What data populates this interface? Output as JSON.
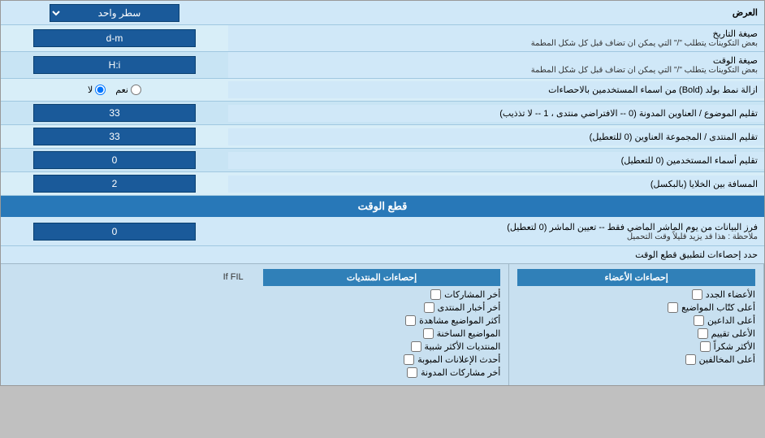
{
  "header": {
    "label": "العرض",
    "dropdown_label": "سطر واحد"
  },
  "rows": [
    {
      "id": "date_format",
      "label": "صيغة التاريخ",
      "sub_label": "بعض التكوينات يتطلب \"/\" التي يمكن ان تضاف قبل كل شكل المطمة",
      "value": "d-m",
      "type": "text"
    },
    {
      "id": "time_format",
      "label": "صيغة الوقت",
      "sub_label": "بعض التكوينات يتطلب \"/\" التي يمكن ان تضاف قبل كل شكل المطمة",
      "value": "H:i",
      "type": "text"
    },
    {
      "id": "bold_remove",
      "label": "ازالة نمط بولد (Bold) من اسماء المستخدمين بالاحصاءات",
      "type": "radio",
      "options": [
        {
          "label": "نعم",
          "value": "yes"
        },
        {
          "label": "لا",
          "value": "no",
          "checked": true
        }
      ]
    },
    {
      "id": "topics_count",
      "label": "تقليم الموضوع / العناوين المدونة (0 -- الافتراضي منتدى ، 1 -- لا تذذيب)",
      "value": "33",
      "type": "text"
    },
    {
      "id": "forum_addresses",
      "label": "تقليم المنتدى / المجموعة العناوين (0 للتعطيل)",
      "value": "33",
      "type": "text"
    },
    {
      "id": "usernames_trim",
      "label": "تقليم أسماء المستخدمين (0 للتعطيل)",
      "value": "0",
      "type": "text"
    },
    {
      "id": "cell_spacing",
      "label": "المسافة بين الخلايا (بالبكسل)",
      "value": "2",
      "type": "text"
    }
  ],
  "time_cut_section": {
    "title": "قطع الوقت",
    "row": {
      "label": "فرز البيانات من يوم الماشر الماضي فقط -- تعيين الماشر (0 لتعطيل)",
      "note": "ملاحظة : هذا قد يزيد قليلاً وقت التحميل",
      "value": "0"
    },
    "limit_label": "حدد إحصاءات لتطبيق قطع الوقت"
  },
  "checkboxes": {
    "col1": {
      "header": "إحصاءات الأعضاء",
      "items": [
        "الأعضاء الجدد",
        "أعلى كتّاب المواضيع",
        "أعلى الداعين",
        "الأعلى تقييم",
        "الأكثر شكراً",
        "أعلى المخالفين"
      ]
    },
    "col2": {
      "header": "إحصاءات المنتديات",
      "items": [
        "أخر المشاركات",
        "أخر أخبار المنتدى",
        "أكثر المواضيع مشاهدة",
        "المواضيع الساخنة",
        "المنتديات الأكثر شبية",
        "أحدث الإعلانات المبوبة",
        "أخر مشاركات المدونة"
      ]
    },
    "col3": {
      "header": "",
      "items": []
    }
  }
}
